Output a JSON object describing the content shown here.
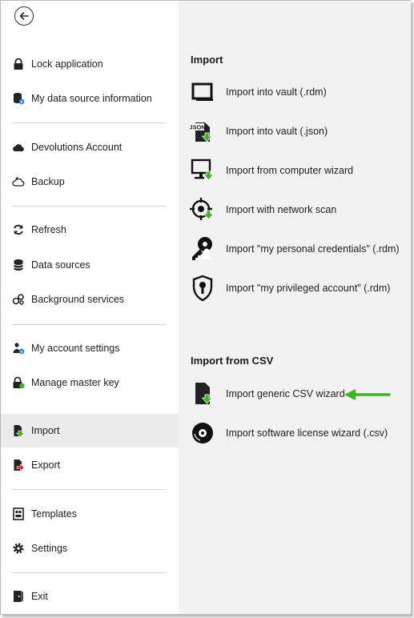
{
  "sidebar": {
    "back_icon": "arrow-left-circle-icon",
    "items": [
      {
        "label": "Lock application",
        "icon": "lock-icon"
      },
      {
        "label": "My data source information",
        "icon": "database-info-icon"
      },
      {
        "label": "Devolutions Account",
        "icon": "cloud-icon"
      },
      {
        "label": "Backup",
        "icon": "cloud-backup-icon"
      },
      {
        "label": "Refresh",
        "icon": "refresh-icon"
      },
      {
        "label": "Data sources",
        "icon": "database-icon"
      },
      {
        "label": "Background services",
        "icon": "services-icon"
      },
      {
        "label": "My account settings",
        "icon": "user-settings-icon"
      },
      {
        "label": "Manage master key",
        "icon": "master-key-icon"
      },
      {
        "label": "Import",
        "icon": "import-icon",
        "active": true
      },
      {
        "label": "Export",
        "icon": "export-icon"
      },
      {
        "label": "Templates",
        "icon": "templates-icon"
      },
      {
        "label": "Settings",
        "icon": "gear-icon"
      },
      {
        "label": "Exit",
        "icon": "exit-icon"
      }
    ]
  },
  "main": {
    "import_section": {
      "title": "Import",
      "items": [
        {
          "label": "Import into vault (.rdm)",
          "icon": "vault-rdm-icon"
        },
        {
          "label": "Import into vault (.json)",
          "icon": "json-file-icon",
          "badge": "JSON"
        },
        {
          "label": "Import from computer wizard",
          "icon": "computer-import-icon"
        },
        {
          "label": "Import with network scan",
          "icon": "network-scan-icon"
        },
        {
          "label": "Import \"my personal credentials\" (.rdm)",
          "icon": "personal-credentials-icon"
        },
        {
          "label": "Import \"my privileged account\" (.rdm)",
          "icon": "privileged-account-icon"
        }
      ]
    },
    "csv_section": {
      "title": "Import from CSV",
      "items": [
        {
          "label": "Import generic CSV wizard",
          "icon": "csv-import-icon"
        },
        {
          "label": "Import software license wizard (.csv)",
          "icon": "software-license-disc-icon"
        }
      ]
    },
    "annotation": {
      "icon": "green-arrow-icon",
      "color": "#3cb521"
    }
  },
  "colors": {
    "accent_green": "#3cb521",
    "icon_dark": "#222222",
    "active_bg": "#ececec",
    "panel_bg": "#f2f2f2"
  }
}
